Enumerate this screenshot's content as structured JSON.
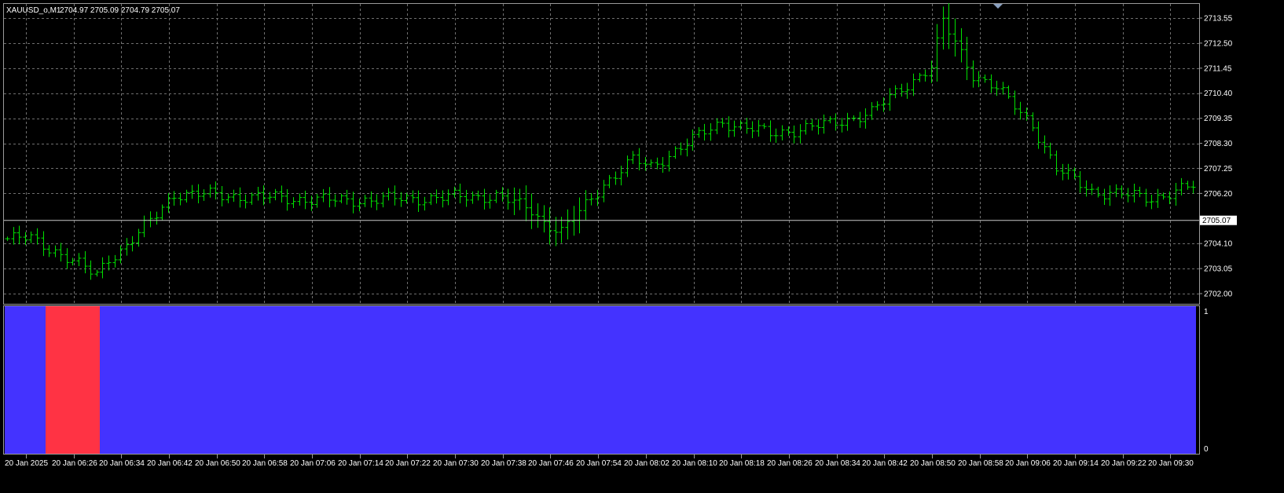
{
  "header": {
    "symbol": "XAUUSD_o,M1",
    "ohlc": "2704.97 2705.09 2704.79 2705.07"
  },
  "colors": {
    "background": "#000000",
    "grid": "#6f6f6f",
    "bar": "#00e000",
    "frame": "#9a9a9a",
    "indicator_on": "#4433ff",
    "indicator_off": "#ff3344",
    "bid_line": "#c8c8c8",
    "price_tag_bg": "#ffffff",
    "price_tag_fg": "#000000"
  },
  "price_axis": {
    "ticks": [
      "2713.55",
      "2712.50",
      "2711.45",
      "2710.40",
      "2709.35",
      "2708.30",
      "2707.25",
      "2706.20",
      "2704.10",
      "2703.05",
      "2702.00"
    ],
    "current": "2705.07"
  },
  "indicator_axis": {
    "top": "1",
    "bottom": "0"
  },
  "time_axis": {
    "labels": [
      "20 Jan 2025",
      "20 Jan 06:26",
      "20 Jan 06:34",
      "20 Jan 06:42",
      "20 Jan 06:50",
      "20 Jan 06:58",
      "20 Jan 07:06",
      "20 Jan 07:14",
      "20 Jan 07:22",
      "20 Jan 07:30",
      "20 Jan 07:38",
      "20 Jan 07:46",
      "20 Jan 07:54",
      "20 Jan 08:02",
      "20 Jan 08:10",
      "20 Jan 08:18",
      "20 Jan 08:26",
      "20 Jan 08:34",
      "20 Jan 08:42",
      "20 Jan 08:50",
      "20 Jan 08:58",
      "20 Jan 09:06",
      "20 Jan 09:14",
      "20 Jan 09:22",
      "20 Jan 09:30"
    ]
  },
  "chart_data": {
    "type": "ohlc",
    "ylim": [
      2702.0,
      2714.0
    ],
    "bars_count": 200,
    "anchors_close": [
      [
        0,
        2704.3
      ],
      [
        4,
        2704.3
      ],
      [
        8,
        2703.8
      ],
      [
        14,
        2702.9
      ],
      [
        15,
        2702.8
      ],
      [
        17,
        2703.5
      ],
      [
        20,
        2704.0
      ],
      [
        25,
        2705.3
      ],
      [
        28,
        2706.2
      ],
      [
        55,
        2705.9
      ],
      [
        70,
        2706.0
      ],
      [
        82,
        2706.1
      ],
      [
        88,
        2705.5
      ],
      [
        90,
        2705.0
      ],
      [
        93,
        2704.6
      ],
      [
        96,
        2705.4
      ],
      [
        100,
        2706.6
      ],
      [
        105,
        2707.6
      ],
      [
        108,
        2707.3
      ],
      [
        112,
        2708.0
      ],
      [
        120,
        2709.2
      ],
      [
        128,
        2708.7
      ],
      [
        138,
        2709.1
      ],
      [
        145,
        2709.6
      ],
      [
        150,
        2710.6
      ],
      [
        155,
        2711.5
      ],
      [
        157,
        2713.4
      ],
      [
        162,
        2711.2
      ],
      [
        166,
        2710.6
      ],
      [
        172,
        2709.1
      ],
      [
        176,
        2707.2
      ],
      [
        182,
        2706.3
      ],
      [
        192,
        2706.0
      ],
      [
        199,
        2706.5
      ]
    ],
    "indicator": {
      "type": "histogram",
      "segments": [
        {
          "from_bar": 0,
          "to_bar": 6,
          "value": 1,
          "state": "on"
        },
        {
          "from_bar": 7,
          "to_bar": 15,
          "value": 1,
          "state": "off"
        },
        {
          "from_bar": 16,
          "to_bar": 199,
          "value": 1,
          "state": "on"
        }
      ]
    }
  }
}
